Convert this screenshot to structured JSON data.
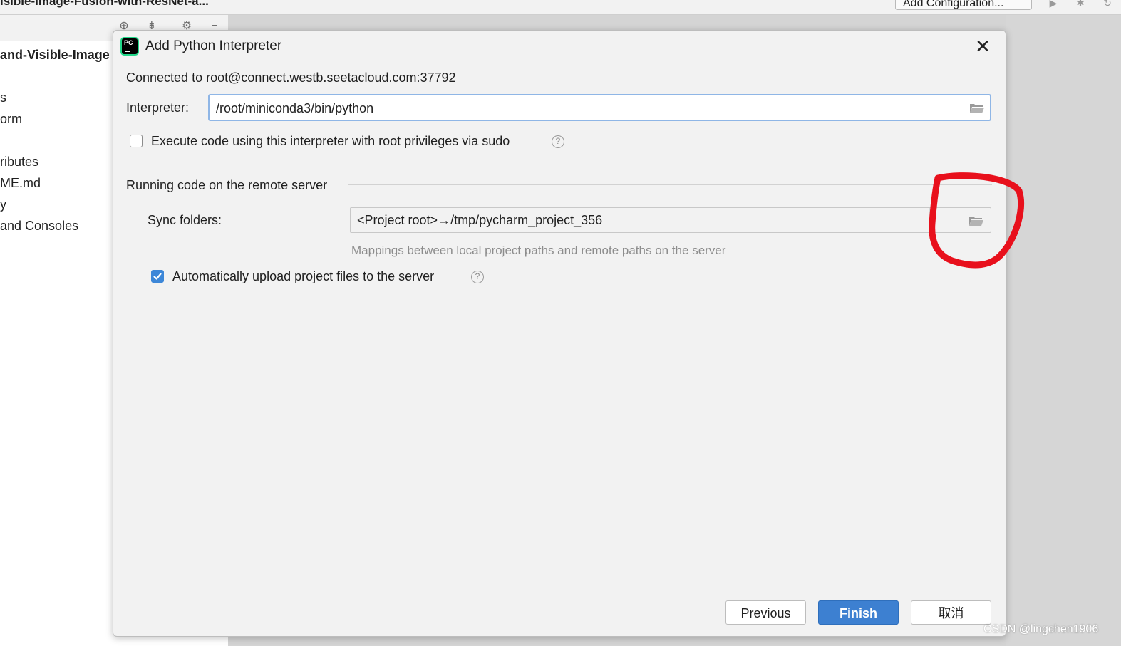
{
  "ide": {
    "title_fragment": "isible-Image-Fusion-with-ResNet-a...",
    "run_config_label": "Add Configuration...",
    "project_root_fragment": "and-Visible-Image",
    "tree_items": [
      "s",
      "orm",
      "ributes",
      "ME.md",
      "y",
      " and Consoles"
    ]
  },
  "dialog": {
    "title": "Add Python Interpreter",
    "connected_text": "Connected to root@connect.westb.seetacloud.com:37792",
    "interpreter_label": "Interpreter:",
    "interpreter_value": "/root/miniconda3/bin/python",
    "sudo_checkbox": {
      "label": "Execute code using this interpreter with root privileges via sudo",
      "checked": false
    },
    "section_title": "Running code on the remote server",
    "sync_label": "Sync folders:",
    "sync_value": "<Project root>→/tmp/pycharm_project_356",
    "sync_hint": "Mappings between local project paths and remote paths on the server",
    "upload_checkbox": {
      "label": "Automatically upload project files to the server",
      "checked": true
    },
    "help_glyph": "?",
    "buttons": {
      "previous": "Previous",
      "finish": "Finish",
      "cancel": "取消"
    }
  },
  "watermark": "CSDN @lingchen1906",
  "colors": {
    "accent": "#3d80d1",
    "focus_border": "#8fb6e6",
    "annotation": "#e8101c",
    "dialog_bg": "#f2f2f2",
    "logo_green": "#21d789"
  },
  "icons": [
    "close-icon",
    "folder-open-icon",
    "help-icon",
    "checkmark-icon",
    "pycharm-logo-icon",
    "run-icon",
    "debug-icon",
    "gear-icon"
  ]
}
